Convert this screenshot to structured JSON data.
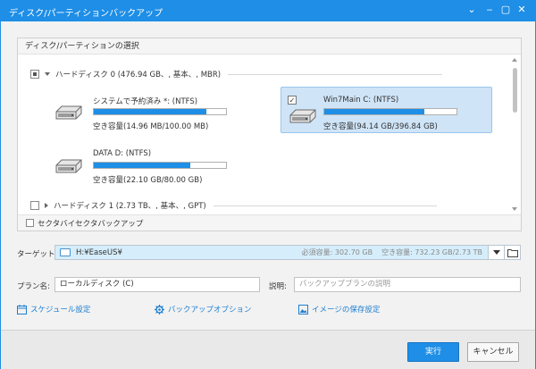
{
  "window": {
    "title": "ディスク/パーティションバックアップ",
    "controls": {
      "minimize": "‒",
      "maximize": "▢",
      "close": "✕",
      "chevron": "⌄"
    }
  },
  "selection_panel": {
    "header": "ディスク/パーティションの選択",
    "disks": [
      {
        "label": "ハードディスク 0 (476.94 GB、, 基本、, MBR)",
        "check_state": "partial",
        "expanded": true,
        "partitions": [
          {
            "name": "システムで予約済み *: (NTFS)",
            "free": "空き容量(14.96 MB/100.00 MB)",
            "fill_fraction": 0.85,
            "selected": false
          },
          {
            "name": "Win7Main C: (NTFS)",
            "free": "空き容量(94.14 GB/396.84 GB)",
            "fill_fraction": 0.76,
            "selected": true
          },
          {
            "name": "DATA D: (NTFS)",
            "free": "空き容量(22.10 GB/80.00 GB)",
            "fill_fraction": 0.73,
            "selected": false
          }
        ]
      },
      {
        "label": "ハードディスク 1 (2.73 TB、, 基本、, GPT)",
        "check_state": "unchecked",
        "expanded": false
      }
    ],
    "sector_backup": "セクタバイセクタバックアップ"
  },
  "target": {
    "label": "ターゲット:",
    "path": "H:¥EaseUS¥",
    "required": "必須容量: 302.70 GB",
    "free": "空き容量: 732.23 GB/2.73 TB"
  },
  "plan": {
    "label": "プラン名:",
    "value": "ローカルディスク (C)"
  },
  "description": {
    "label": "説明:",
    "placeholder": "バックアッププランの説明"
  },
  "links": {
    "schedule": "スケジュール設定",
    "options": "バックアップオプション",
    "image_settings": "イメージの保存設定"
  },
  "buttons": {
    "run": "実行",
    "cancel": "キャンセル"
  },
  "colors": {
    "accent": "#1e8ee6",
    "selected_bg": "#cfe4f7",
    "target_bg": "#d6eefb"
  }
}
